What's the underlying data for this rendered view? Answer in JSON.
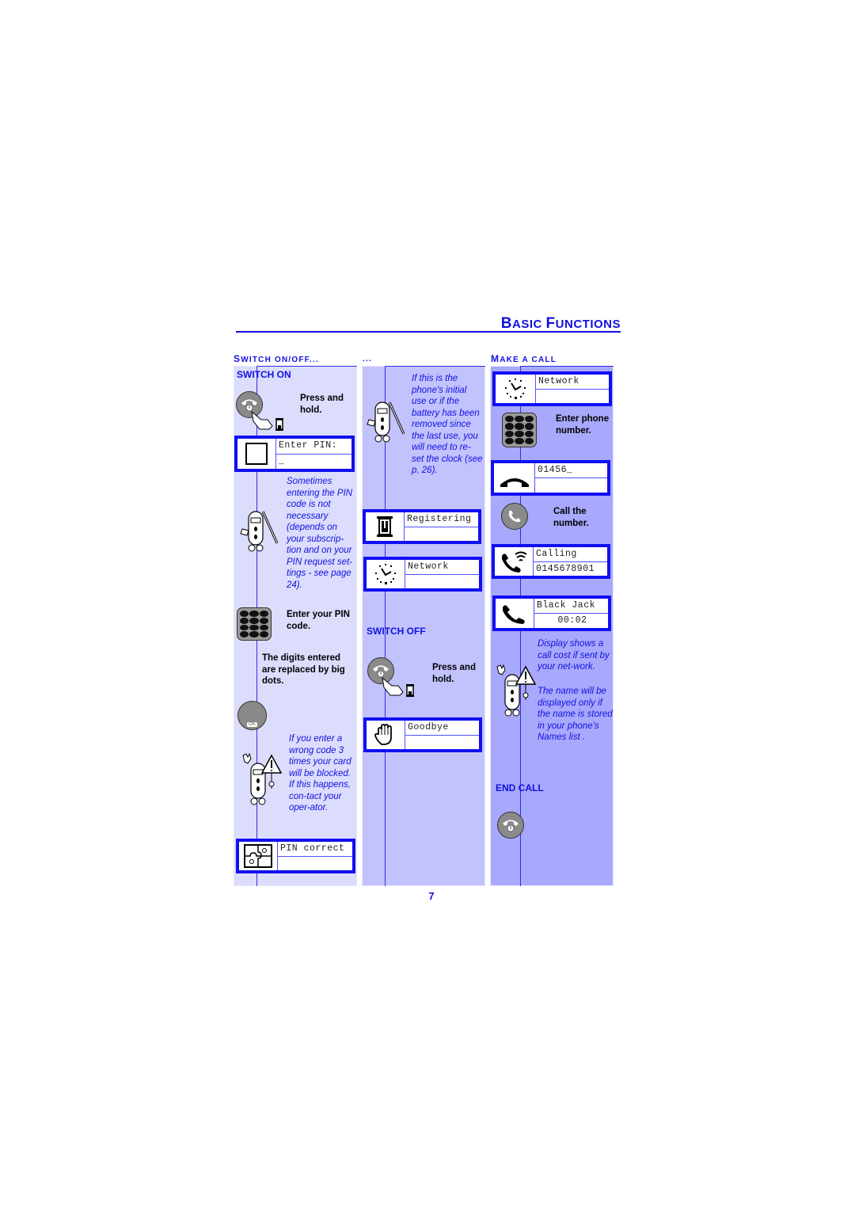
{
  "header": {
    "title_first": "B",
    "title_rest": "asic ",
    "title_second_first": "f",
    "title_second_rest": "unctions",
    "title": "Basic functions"
  },
  "sections": {
    "col1_head_first": "S",
    "col1_head_rest": "witch on/off...",
    "col2_head": "...",
    "col3_head_first": "M",
    "col3_head_rest": "ake a call"
  },
  "col1": {
    "subtitle": "SWITCH ON",
    "press_hold": "Press and hold.",
    "lcd_enter_pin": {
      "line1": "Enter PIN:",
      "line2": "_"
    },
    "note_pin": "Sometimes entering the PIN code is not necessary (depends on your subscrip-tion and on your PIN request set-tings - see page 24).",
    "enter_pin_code": "Enter your PIN code.",
    "digits_replaced": "The digits entered are replaced by big dots.",
    "ok_label": "OK",
    "note_wrong_code": "If you enter a wrong code 3 times your card will be blocked. If this happens, con-tact your oper-ator.",
    "lcd_pin_correct": {
      "line1": "PIN correct",
      "line2": ""
    }
  },
  "col2": {
    "note_clock": "If this is the phone's initial use or if the battery has been removed since the last use, you will need to re-set the clock (see p. 26).",
    "lcd_registering": {
      "line1": "Registering",
      "line2": ""
    },
    "lcd_network": {
      "line1": "Network",
      "line2": ""
    },
    "subtitle_off": "SWITCH OFF",
    "press_hold": "Press and hold.",
    "lcd_goodbye": {
      "line1": "Goodbye",
      "line2": ""
    }
  },
  "col3": {
    "lcd_network": {
      "line1": "Network",
      "line2": ""
    },
    "enter_phone": "Enter phone number.",
    "lcd_dial": {
      "line1": "01456_",
      "line2": ""
    },
    "call_number": "Call the number.",
    "lcd_calling": {
      "line1": "Calling",
      "line2": "0145678901"
    },
    "lcd_connected": {
      "line1": "Black Jack",
      "line2": "00:02"
    },
    "note_cost": "Display shows a call cost if sent by your net-work.",
    "note_name": "The name will be displayed only if the name is stored in your phone's Names list .",
    "subtitle_end": "END CALL"
  },
  "footer": {
    "page_number": "7"
  },
  "colors": {
    "accent": "#1010e0",
    "panel1": "#dcdcfd",
    "panel2": "#c2c2fd",
    "panel3": "#a8a8fc",
    "lcd_border": "#1010f0"
  }
}
